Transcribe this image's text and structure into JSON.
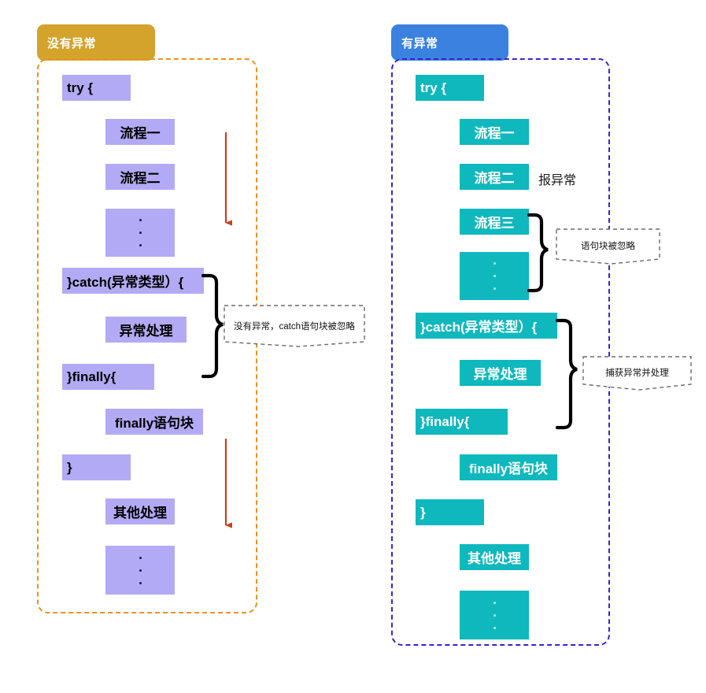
{
  "meta": {
    "diagram_title": "try-catch-finally execution flow comparison",
    "colors": {
      "left_header_bg": "#d4a32c",
      "left_frame_border": "#e8921f",
      "left_block_bg": "#b3aaf5",
      "left_block_text": "#000000",
      "right_header_bg": "#3b82e0",
      "right_frame_border": "#3b23c8",
      "right_block_bg": "#0fb8bd",
      "right_block_text": "#ffffff",
      "arrow": "#cc3d22",
      "brace": "#000000",
      "note_border": "#6b6b6b"
    }
  },
  "left_panel": {
    "header": "没有异常",
    "blocks": [
      {
        "text": "try {",
        "align": "left"
      },
      {
        "text": "流程一",
        "align": "center"
      },
      {
        "text": "流程二",
        "align": "center"
      },
      {
        "text": "",
        "align": "dots"
      },
      {
        "text": "}catch(异常类型）{",
        "align": "left"
      },
      {
        "text": "异常处理",
        "align": "center"
      },
      {
        "text": "}finally{",
        "align": "left"
      },
      {
        "text": "finally语句块",
        "align": "center"
      },
      {
        "text": "}",
        "align": "left"
      },
      {
        "text": "其他处理",
        "align": "center"
      },
      {
        "text": "",
        "align": "dots"
      }
    ],
    "notes": [
      {
        "text": "没有异常，catch语句块被忽略"
      }
    ],
    "arrows": [
      {
        "name": "flow-arrow-top"
      },
      {
        "name": "flow-arrow-bottom"
      }
    ]
  },
  "right_panel": {
    "header": "有异常",
    "blocks": [
      {
        "text": "try {",
        "align": "left"
      },
      {
        "text": "流程一",
        "align": "center"
      },
      {
        "text": "流程二",
        "align": "center"
      },
      {
        "text": "流程三",
        "align": "center"
      },
      {
        "text": "",
        "align": "dots"
      },
      {
        "text": "}catch(异常类型）{",
        "align": "left"
      },
      {
        "text": "异常处理",
        "align": "center"
      },
      {
        "text": "}finally{",
        "align": "left"
      },
      {
        "text": "finally语句块",
        "align": "center"
      },
      {
        "text": "}",
        "align": "left"
      },
      {
        "text": "其他处理",
        "align": "center"
      },
      {
        "text": "",
        "align": "dots"
      }
    ],
    "labels": [
      {
        "text": "报异常"
      }
    ],
    "notes": [
      {
        "text": "语句块被忽略"
      },
      {
        "text": "捕获异常并处理"
      }
    ]
  }
}
